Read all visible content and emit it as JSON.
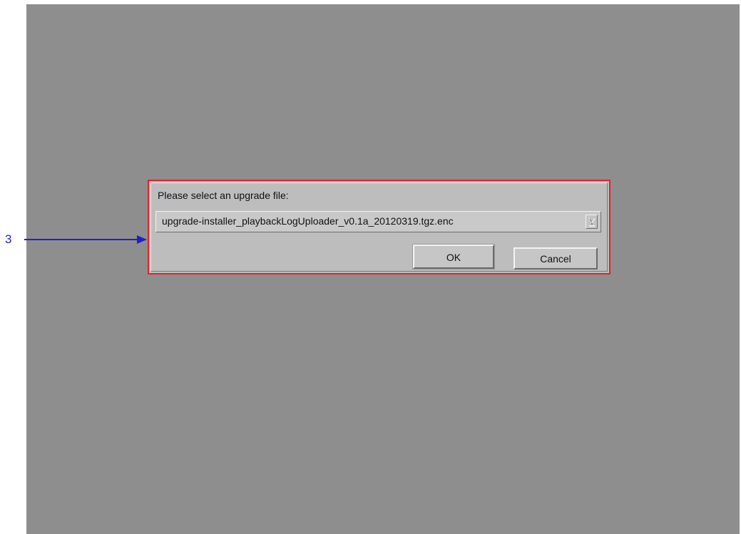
{
  "callout": {
    "number": "3",
    "color": "#1f1fc8"
  },
  "dialog": {
    "prompt": "Please select an upgrade file:",
    "file_select": {
      "value": "upgrade-installer_playbackLogUploader_v0.1a_20120319.tgz.enc",
      "icon": "chevron-down-icon"
    },
    "ok_label": "OK",
    "cancel_label": "Cancel",
    "highlight_color": "#e8202a"
  },
  "screen": {
    "background": "#8e8e8e"
  }
}
